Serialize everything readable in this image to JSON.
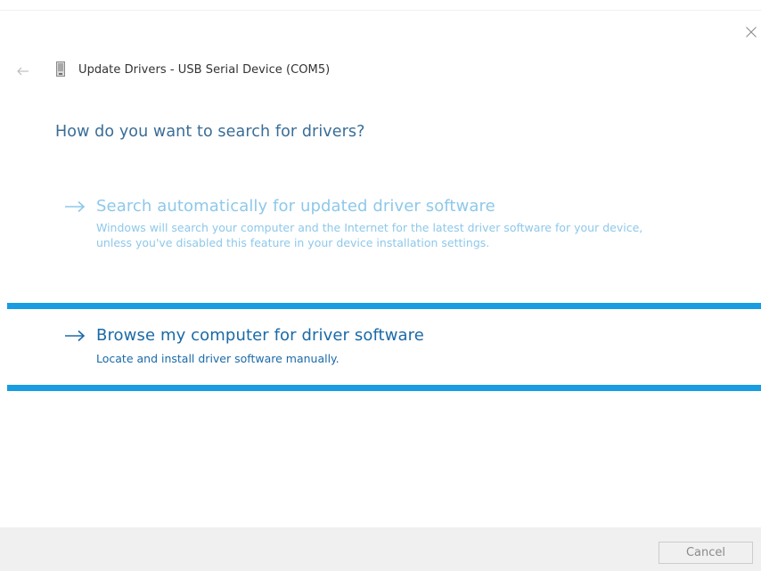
{
  "window": {
    "title": "Update Drivers - USB Serial Device (COM5)"
  },
  "heading": "How do you want to search for drivers?",
  "options": [
    {
      "title": "Search automatically for updated driver software",
      "description": "Windows will search your computer and the Internet for the latest driver software for your device, unless you've disabled this feature in your device installation settings.",
      "state": "disabled"
    },
    {
      "title": "Browse my computer for driver software",
      "description": "Locate and install driver software manually.",
      "state": "focused"
    }
  ],
  "footer": {
    "cancel_label": "Cancel"
  },
  "icons": {
    "close": "close-icon",
    "back": "back-arrow-icon",
    "device": "usb-device-icon",
    "option_arrow": "arrow-right-icon"
  },
  "colors": {
    "accent": "#1a9ce0",
    "heading": "#3a6d96",
    "link_active": "#1a6aa8",
    "link_disabled": "#8ec8ea",
    "footer_bg": "#f0f0f0"
  }
}
